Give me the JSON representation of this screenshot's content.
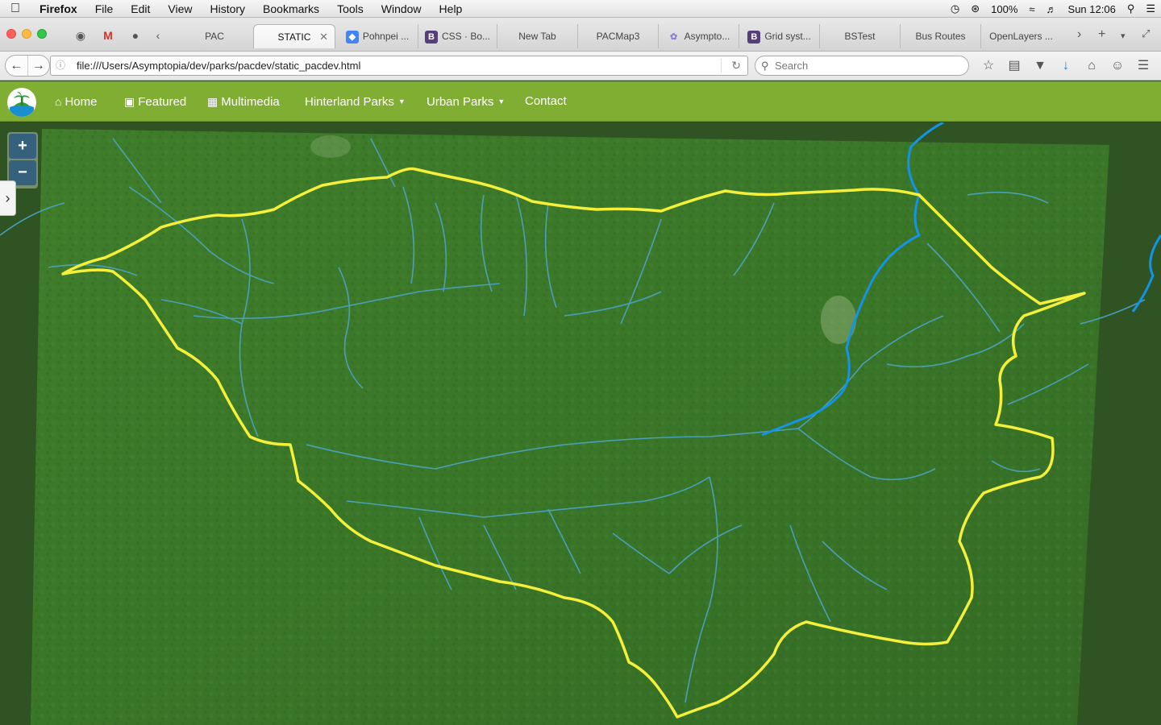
{
  "menubar": {
    "app": "Firefox",
    "items": [
      "File",
      "Edit",
      "View",
      "History",
      "Bookmarks",
      "Tools",
      "Window",
      "Help"
    ],
    "battery": "100%",
    "clock": "Sun 12:06"
  },
  "tabs": [
    {
      "label": "PAC"
    },
    {
      "label": "STATIC",
      "active": true
    },
    {
      "label": "Pohnpei ..."
    },
    {
      "label": "CSS · Bo..."
    },
    {
      "label": "New Tab"
    },
    {
      "label": "PACMap3"
    },
    {
      "label": "Asympto..."
    },
    {
      "label": "Grid syst..."
    },
    {
      "label": "BSTest"
    },
    {
      "label": "Bus Routes"
    },
    {
      "label": "OpenLayers ..."
    }
  ],
  "toolbar": {
    "url": "file:///Users/Asymptopia/dev/parks/pacdev/static_pacdev.html",
    "search_placeholder": "Search"
  },
  "site_nav": {
    "home": "Home",
    "featured": "Featured",
    "multimedia": "Multimedia",
    "hinterland": "Hinterland Parks",
    "urban": "Urban Parks",
    "contact": "Contact"
  },
  "map": {
    "zoom_in": "+",
    "zoom_out": "−",
    "sidebar_toggle": "›",
    "colors": {
      "imagery": "#3d7a2a",
      "boundary": "#f4f03a",
      "streams": "#4aa6c8",
      "main_river": "#1593e6"
    }
  },
  "colors": {
    "site_nav_bg": "#80ae33"
  }
}
